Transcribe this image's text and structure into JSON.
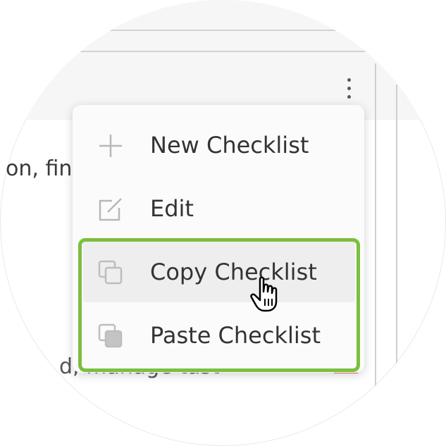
{
  "menu": {
    "items": [
      {
        "label": "New Checklist",
        "icon": "plus-icon"
      },
      {
        "label": "Edit",
        "icon": "edit-icon"
      },
      {
        "label": "Copy Checklist",
        "icon": "copy-icon"
      },
      {
        "label": "Paste Checklist",
        "icon": "paste-icon"
      }
    ],
    "highlighted": "Copy Checklist"
  },
  "background": {
    "text_line_1": "on, fin",
    "text_line_2": "d, manage tast"
  },
  "colors": {
    "highlight_border": "#7bbf3f",
    "menu_background": "#fbfbfb",
    "hover_background": "#eeeeee",
    "text": "#333333"
  }
}
